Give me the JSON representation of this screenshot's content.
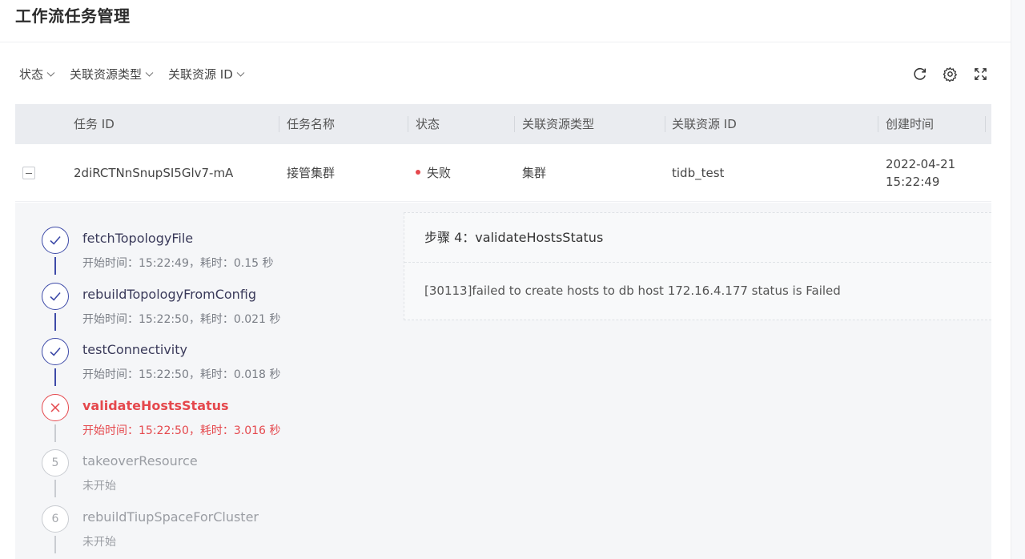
{
  "page": {
    "title": "工作流任务管理"
  },
  "filters": [
    {
      "label": "状态"
    },
    {
      "label": "关联资源类型"
    },
    {
      "label": "关联资源 ID"
    }
  ],
  "toolbar": {
    "refresh_icon": "refresh-icon",
    "settings_icon": "gear-icon",
    "fullscreen_icon": "fullscreen-icon"
  },
  "table": {
    "columns": [
      "任务 ID",
      "任务名称",
      "状态",
      "关联资源类型",
      "关联资源 ID",
      "创建时间"
    ],
    "rows": [
      {
        "task_id": "2diRCTNnSnupSI5Glv7-mA",
        "task_name": "接管集群",
        "status": "失败",
        "resource_type": "集群",
        "resource_id": "tidb_test",
        "created_date": "2022-04-21",
        "created_time": "15:22:49"
      }
    ]
  },
  "steps": [
    {
      "index": "1",
      "name": "fetchTopologyFile",
      "meta": "开始时间：15:22:49，耗时：0.15 秒",
      "state": "done"
    },
    {
      "index": "2",
      "name": "rebuildTopologyFromConfig",
      "meta": "开始时间：15:22:50，耗时：0.021 秒",
      "state": "done"
    },
    {
      "index": "3",
      "name": "testConnectivity",
      "meta": "开始时间：15:22:50，耗时：0.018 秒",
      "state": "done"
    },
    {
      "index": "4",
      "name": "validateHostsStatus",
      "meta": "开始时间：15:22:50，耗时：3.016 秒",
      "state": "fail"
    },
    {
      "index": "5",
      "name": "takeoverResource",
      "meta": "未开始",
      "state": "pending"
    },
    {
      "index": "6",
      "name": "rebuildTiupSpaceForCluster",
      "meta": "未开始",
      "state": "pending"
    }
  ],
  "detail": {
    "prefix": "步骤 4：",
    "step_name": "validateHostsStatus",
    "message": "[30113]failed to create hosts to db host 172.16.4.177 status is Failed"
  },
  "colors": {
    "accent": "#3d4aa8",
    "error": "#e5484d",
    "header_bg": "#eaecf0",
    "panel_bg": "#f5f6f8"
  }
}
